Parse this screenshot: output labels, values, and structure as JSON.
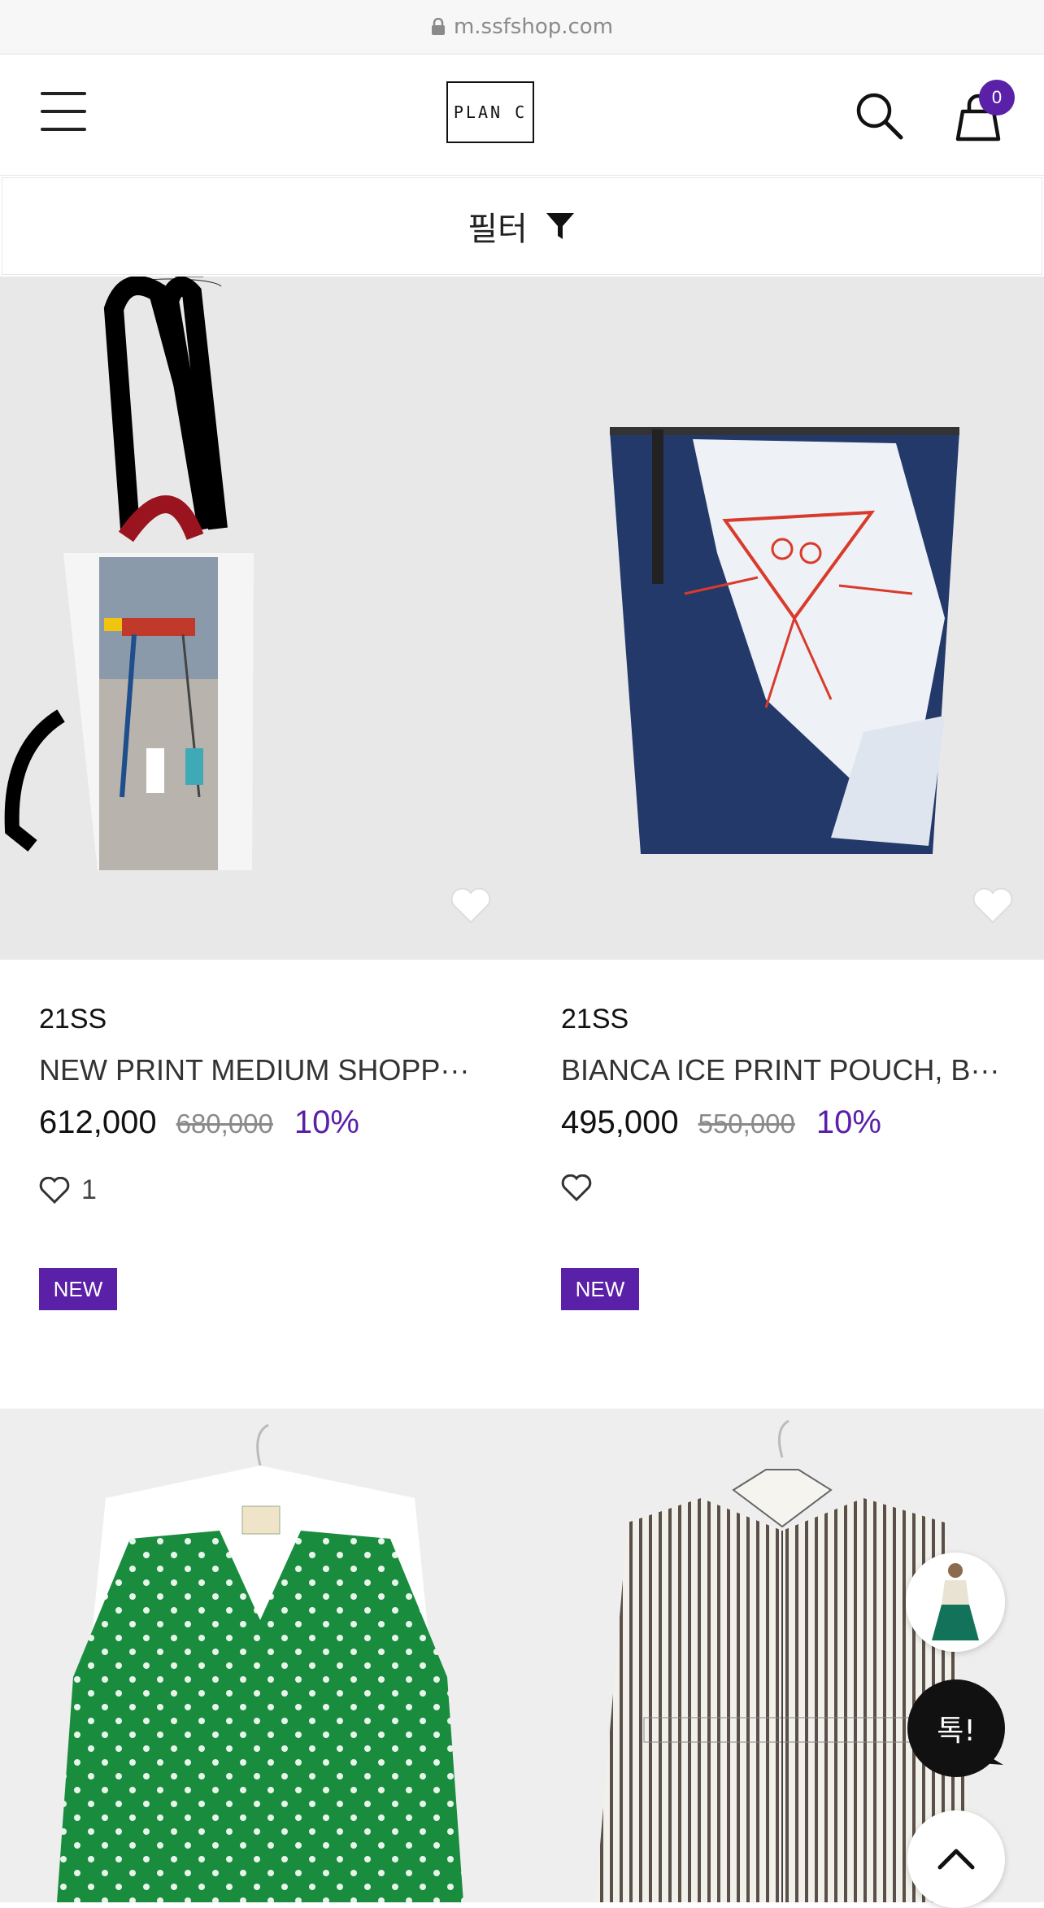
{
  "browser": {
    "url": "m.ssfshop.com"
  },
  "header": {
    "logo_text": "PLAN C",
    "cart_count": "0"
  },
  "filter": {
    "label": "필터"
  },
  "products": [
    {
      "season": "21SS",
      "name": "NEW PRINT MEDIUM SHOPP···",
      "price": "612,000",
      "original_price": "680,000",
      "discount": "10%",
      "like_count": "1",
      "badge": "NEW"
    },
    {
      "season": "21SS",
      "name": "BIANCA ICE PRINT POUCH, B···",
      "price": "495,000",
      "original_price": "550,000",
      "discount": "10%",
      "like_count": "",
      "badge": "NEW"
    }
  ],
  "floating": {
    "chat_label": "톡!"
  },
  "colors": {
    "accent": "#5a20a8",
    "image_bg": "#e8e8e8"
  }
}
